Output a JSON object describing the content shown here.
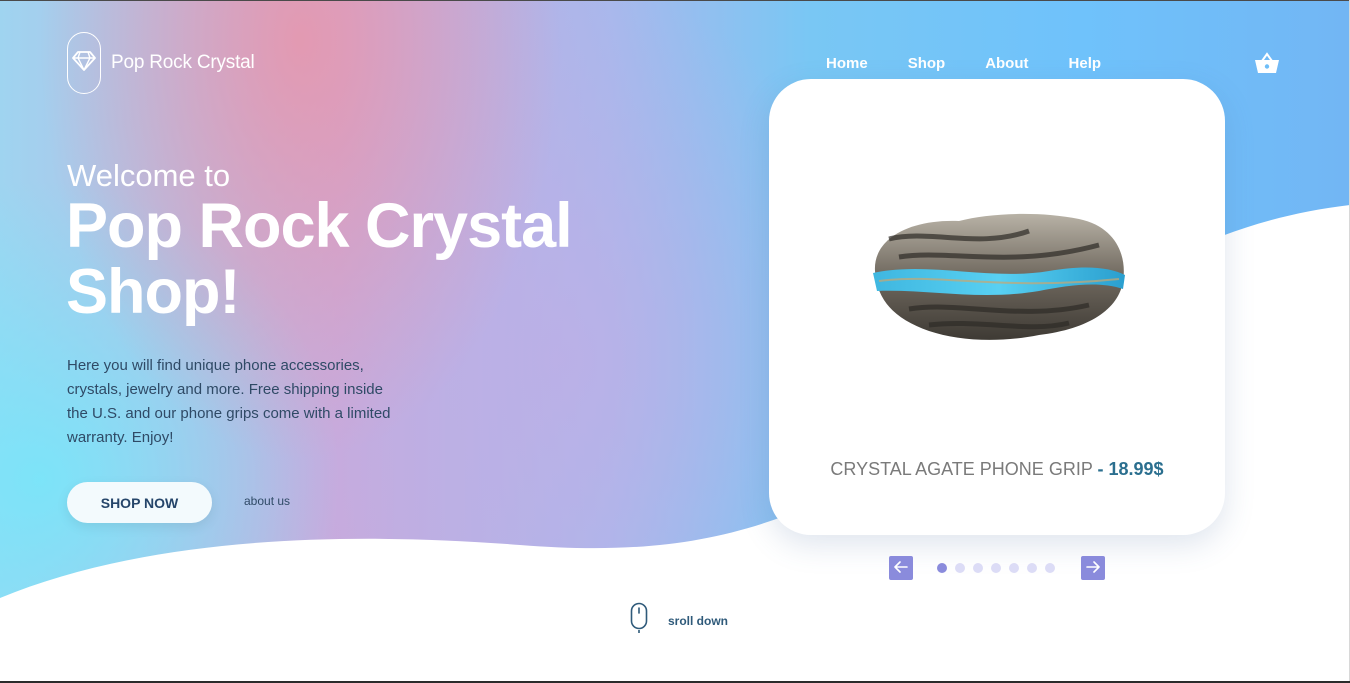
{
  "brand": {
    "name": "Pop Rock Crystal"
  },
  "nav": {
    "items": [
      "Home",
      "Shop",
      "About",
      "Help"
    ]
  },
  "icons": {
    "logo": "diamond-icon",
    "cart": "basket-icon",
    "prev": "arrow-left-icon",
    "next": "arrow-right-icon",
    "scroll": "mouse-icon"
  },
  "hero": {
    "welcome": "Welcome to",
    "headline": "Pop Rock Crystal Shop!",
    "description": "Here you will find unique phone accessories, crystals, jewelry and more. Free shipping inside the U.S. and our phone grips come with a limited warranty. Enjoy!",
    "shop_button": "SHOP NOW",
    "about_link": "about us"
  },
  "product": {
    "name": "CRYSTAL AGATE PHONE GRIP",
    "price": "- 18.99$"
  },
  "carousel": {
    "total": 7,
    "active_index": 0
  },
  "scroll": {
    "label": "sroll down"
  },
  "colors": {
    "accent": "#8a8bdc",
    "text_dark": "#2f4a66",
    "price": "#2b6f8f",
    "white": "#ffffff"
  }
}
